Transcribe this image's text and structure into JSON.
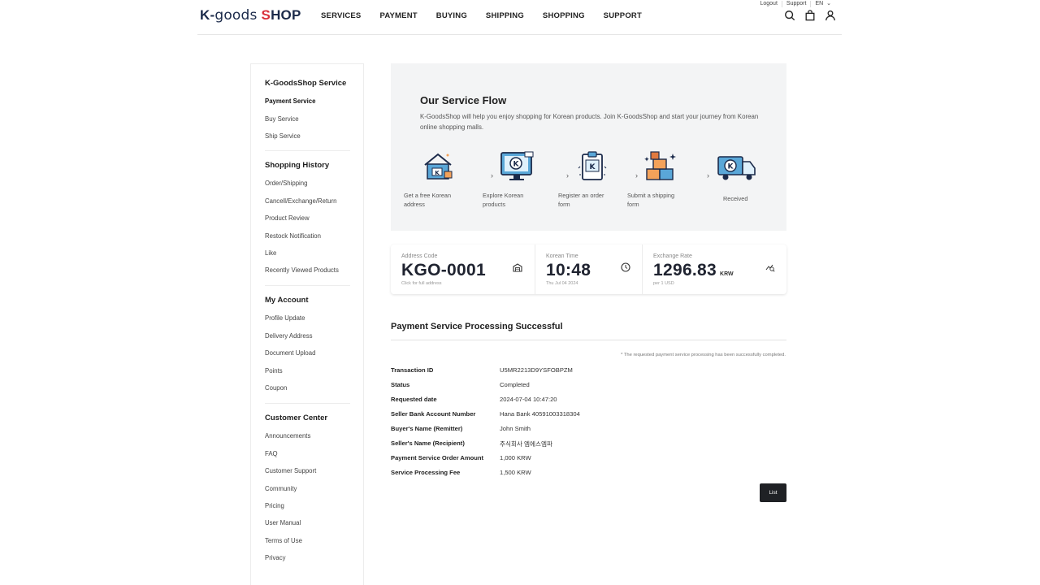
{
  "header": {
    "logo": {
      "k": "K-",
      "goods": "goods",
      "s": "S",
      "hop": "HOP"
    },
    "nav": [
      "SERVICES",
      "PAYMENT",
      "BUYING",
      "SHIPPING",
      "SHOPPING",
      "SUPPORT"
    ],
    "util": {
      "logout": "Logout",
      "support": "Support",
      "lang": "EN"
    },
    "icons": [
      "search-icon",
      "cart-icon",
      "user-icon"
    ]
  },
  "sidebar": {
    "groups": [
      {
        "title": "K-GoodsShop Service",
        "items": [
          "Payment Service",
          "Buy Service",
          "Ship Service"
        ],
        "active": 0
      },
      {
        "title": "Shopping History",
        "items": [
          "Order/Shipping",
          "Cancell/Exchange/Return",
          "Product Review",
          "Restock Notification",
          "Like",
          "Recently Viewed Products"
        ]
      },
      {
        "title": "My Account",
        "items": [
          "Profile Update",
          "Delivery Address",
          "Document Upload",
          "Points",
          "Coupon"
        ]
      },
      {
        "title": "Customer Center",
        "items": [
          "Announcements",
          "FAQ",
          "Customer Support",
          "Community",
          "Pricing",
          "User Manual",
          "Terms of Use",
          "Privacy"
        ]
      }
    ]
  },
  "flow": {
    "title": "Our Service Flow",
    "description": "K-GoodsShop will help you enjoy shopping for Korean products. Join K-GoodsShop and start your journey from Korean online shopping malls.",
    "steps": [
      {
        "line1": "Get a free Korean",
        "line2": "address",
        "icon": "house-icon"
      },
      {
        "line1": "Explore Korean",
        "line2": "products",
        "icon": "monitor-icon"
      },
      {
        "line1": "Register an order",
        "line2": "form",
        "icon": "clipboard-icon"
      },
      {
        "line1": "Submit a shipping",
        "line2": "form",
        "icon": "boxes-icon"
      },
      {
        "line1": "Received",
        "line2": "",
        "icon": "truck-icon"
      }
    ],
    "arrow": "›"
  },
  "info": {
    "address": {
      "label": "Address Code",
      "value": "KGO-0001",
      "sub": "Click for full address",
      "icon": "warehouse-icon"
    },
    "time": {
      "label": "Korean Time",
      "value": "10:48",
      "sub": "Thu Jul 04 2024",
      "icon": "clock-icon"
    },
    "rate": {
      "label": "Exchange Rate",
      "value": "1296.83",
      "unit": "KRW",
      "sub": "per 1 USD",
      "icon": "chart-search-icon"
    }
  },
  "result": {
    "title": "Payment Service Processing Successful",
    "note": "* The requested payment service processing has been successfully completed.",
    "rows": [
      {
        "key": "Transaction ID",
        "value": "U5MR2213D9YSFOBPZM"
      },
      {
        "key": "Status",
        "value": "Completed"
      },
      {
        "key": "Requested date",
        "value": "2024-07-04 10:47:20"
      },
      {
        "key": "Seller Bank Account Number",
        "value": "Hana Bank 40591003318304"
      },
      {
        "key": "Buyer's Name (Remitter)",
        "value": "John Smith"
      },
      {
        "key": "Seller's Name (Recipient)",
        "value": "주식회사 엠에스엠파"
      },
      {
        "key": "Payment Service Order Amount",
        "value": "1,000 KRW"
      },
      {
        "key": "Service Processing Fee",
        "value": "1,500 KRW"
      }
    ],
    "list_button": "List"
  }
}
